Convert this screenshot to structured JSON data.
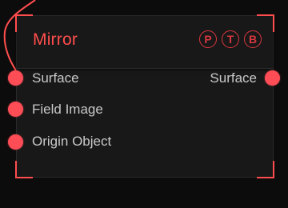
{
  "node": {
    "title": "Mirror",
    "toggles": [
      "P",
      "T",
      "B"
    ],
    "inputs": [
      {
        "label": "Surface"
      },
      {
        "label": "Field Image"
      },
      {
        "label": "Origin Object"
      }
    ],
    "outputs": [
      {
        "label": "Surface"
      }
    ]
  },
  "colors": {
    "accent": "#ff4d4d",
    "socket": "#ff4d56",
    "toggle": "#d9363e",
    "node_bg": "#181818",
    "canvas_bg": "#0c0c0c",
    "label": "#c8c8c8"
  }
}
